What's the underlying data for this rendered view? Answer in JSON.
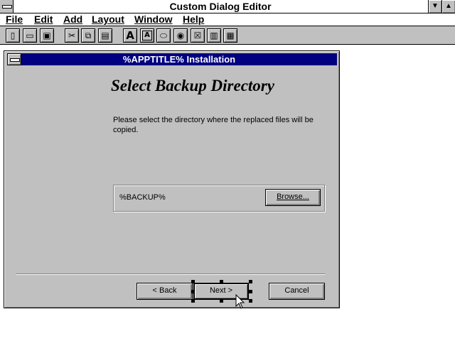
{
  "app": {
    "title": "Custom Dialog Editor",
    "minimize_glyph": "▼",
    "maximize_glyph": "▲"
  },
  "menu": {
    "items": [
      "File",
      "Edit",
      "Add",
      "Layout",
      "Window",
      "Help"
    ]
  },
  "toolbar": {
    "buttons": [
      {
        "name": "new-file-icon",
        "glyph": "▯"
      },
      {
        "name": "open-folder-icon",
        "glyph": "▭"
      },
      {
        "name": "save-disk-icon",
        "glyph": "▣"
      },
      {
        "name": "cut-scissors-icon",
        "glyph": "✂"
      },
      {
        "name": "copy-icon",
        "glyph": "⧉"
      },
      {
        "name": "paste-clipboard-icon",
        "glyph": "▤"
      },
      {
        "name": "static-text-tool-icon",
        "glyph": "A"
      },
      {
        "name": "text-box-tool-icon",
        "glyph": "A"
      },
      {
        "name": "button-tool-icon",
        "glyph": "⬭"
      },
      {
        "name": "radio-button-tool-icon",
        "glyph": "◉"
      },
      {
        "name": "checkbox-tool-icon",
        "glyph": "☒"
      },
      {
        "name": "edit-field-tool-icon",
        "glyph": "▥"
      },
      {
        "name": "list-box-tool-icon",
        "glyph": "▦"
      }
    ]
  },
  "dialog": {
    "title": "%APPTITLE% Installation",
    "heading": "Select Backup Directory",
    "description": "Please select the directory where the replaced  files will be copied.",
    "path_value": "%BACKUP%",
    "browse_label": "Browse...",
    "back_label": "< Back",
    "next_label": "Next >",
    "cancel_label": "Cancel"
  },
  "colors": {
    "dialog_titlebar": "#000080",
    "face": "#c0c0c0"
  }
}
